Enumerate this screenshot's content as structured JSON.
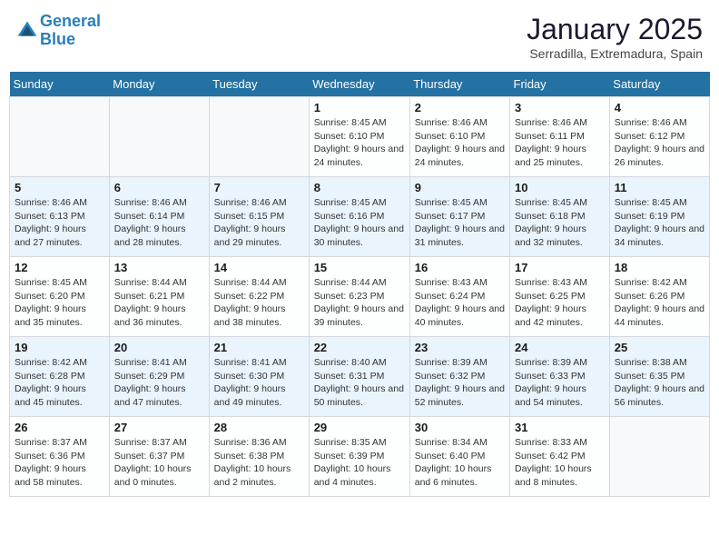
{
  "header": {
    "logo_line1": "General",
    "logo_line2": "Blue",
    "month": "January 2025",
    "location": "Serradilla, Extremadura, Spain"
  },
  "days_of_week": [
    "Sunday",
    "Monday",
    "Tuesday",
    "Wednesday",
    "Thursday",
    "Friday",
    "Saturday"
  ],
  "weeks": [
    [
      {
        "num": "",
        "info": ""
      },
      {
        "num": "",
        "info": ""
      },
      {
        "num": "",
        "info": ""
      },
      {
        "num": "1",
        "info": "Sunrise: 8:45 AM\nSunset: 6:10 PM\nDaylight: 9 hours and 24 minutes."
      },
      {
        "num": "2",
        "info": "Sunrise: 8:46 AM\nSunset: 6:10 PM\nDaylight: 9 hours and 24 minutes."
      },
      {
        "num": "3",
        "info": "Sunrise: 8:46 AM\nSunset: 6:11 PM\nDaylight: 9 hours and 25 minutes."
      },
      {
        "num": "4",
        "info": "Sunrise: 8:46 AM\nSunset: 6:12 PM\nDaylight: 9 hours and 26 minutes."
      }
    ],
    [
      {
        "num": "5",
        "info": "Sunrise: 8:46 AM\nSunset: 6:13 PM\nDaylight: 9 hours and 27 minutes."
      },
      {
        "num": "6",
        "info": "Sunrise: 8:46 AM\nSunset: 6:14 PM\nDaylight: 9 hours and 28 minutes."
      },
      {
        "num": "7",
        "info": "Sunrise: 8:46 AM\nSunset: 6:15 PM\nDaylight: 9 hours and 29 minutes."
      },
      {
        "num": "8",
        "info": "Sunrise: 8:45 AM\nSunset: 6:16 PM\nDaylight: 9 hours and 30 minutes."
      },
      {
        "num": "9",
        "info": "Sunrise: 8:45 AM\nSunset: 6:17 PM\nDaylight: 9 hours and 31 minutes."
      },
      {
        "num": "10",
        "info": "Sunrise: 8:45 AM\nSunset: 6:18 PM\nDaylight: 9 hours and 32 minutes."
      },
      {
        "num": "11",
        "info": "Sunrise: 8:45 AM\nSunset: 6:19 PM\nDaylight: 9 hours and 34 minutes."
      }
    ],
    [
      {
        "num": "12",
        "info": "Sunrise: 8:45 AM\nSunset: 6:20 PM\nDaylight: 9 hours and 35 minutes."
      },
      {
        "num": "13",
        "info": "Sunrise: 8:44 AM\nSunset: 6:21 PM\nDaylight: 9 hours and 36 minutes."
      },
      {
        "num": "14",
        "info": "Sunrise: 8:44 AM\nSunset: 6:22 PM\nDaylight: 9 hours and 38 minutes."
      },
      {
        "num": "15",
        "info": "Sunrise: 8:44 AM\nSunset: 6:23 PM\nDaylight: 9 hours and 39 minutes."
      },
      {
        "num": "16",
        "info": "Sunrise: 8:43 AM\nSunset: 6:24 PM\nDaylight: 9 hours and 40 minutes."
      },
      {
        "num": "17",
        "info": "Sunrise: 8:43 AM\nSunset: 6:25 PM\nDaylight: 9 hours and 42 minutes."
      },
      {
        "num": "18",
        "info": "Sunrise: 8:42 AM\nSunset: 6:26 PM\nDaylight: 9 hours and 44 minutes."
      }
    ],
    [
      {
        "num": "19",
        "info": "Sunrise: 8:42 AM\nSunset: 6:28 PM\nDaylight: 9 hours and 45 minutes."
      },
      {
        "num": "20",
        "info": "Sunrise: 8:41 AM\nSunset: 6:29 PM\nDaylight: 9 hours and 47 minutes."
      },
      {
        "num": "21",
        "info": "Sunrise: 8:41 AM\nSunset: 6:30 PM\nDaylight: 9 hours and 49 minutes."
      },
      {
        "num": "22",
        "info": "Sunrise: 8:40 AM\nSunset: 6:31 PM\nDaylight: 9 hours and 50 minutes."
      },
      {
        "num": "23",
        "info": "Sunrise: 8:39 AM\nSunset: 6:32 PM\nDaylight: 9 hours and 52 minutes."
      },
      {
        "num": "24",
        "info": "Sunrise: 8:39 AM\nSunset: 6:33 PM\nDaylight: 9 hours and 54 minutes."
      },
      {
        "num": "25",
        "info": "Sunrise: 8:38 AM\nSunset: 6:35 PM\nDaylight: 9 hours and 56 minutes."
      }
    ],
    [
      {
        "num": "26",
        "info": "Sunrise: 8:37 AM\nSunset: 6:36 PM\nDaylight: 9 hours and 58 minutes."
      },
      {
        "num": "27",
        "info": "Sunrise: 8:37 AM\nSunset: 6:37 PM\nDaylight: 10 hours and 0 minutes."
      },
      {
        "num": "28",
        "info": "Sunrise: 8:36 AM\nSunset: 6:38 PM\nDaylight: 10 hours and 2 minutes."
      },
      {
        "num": "29",
        "info": "Sunrise: 8:35 AM\nSunset: 6:39 PM\nDaylight: 10 hours and 4 minutes."
      },
      {
        "num": "30",
        "info": "Sunrise: 8:34 AM\nSunset: 6:40 PM\nDaylight: 10 hours and 6 minutes."
      },
      {
        "num": "31",
        "info": "Sunrise: 8:33 AM\nSunset: 6:42 PM\nDaylight: 10 hours and 8 minutes."
      },
      {
        "num": "",
        "info": ""
      }
    ]
  ]
}
